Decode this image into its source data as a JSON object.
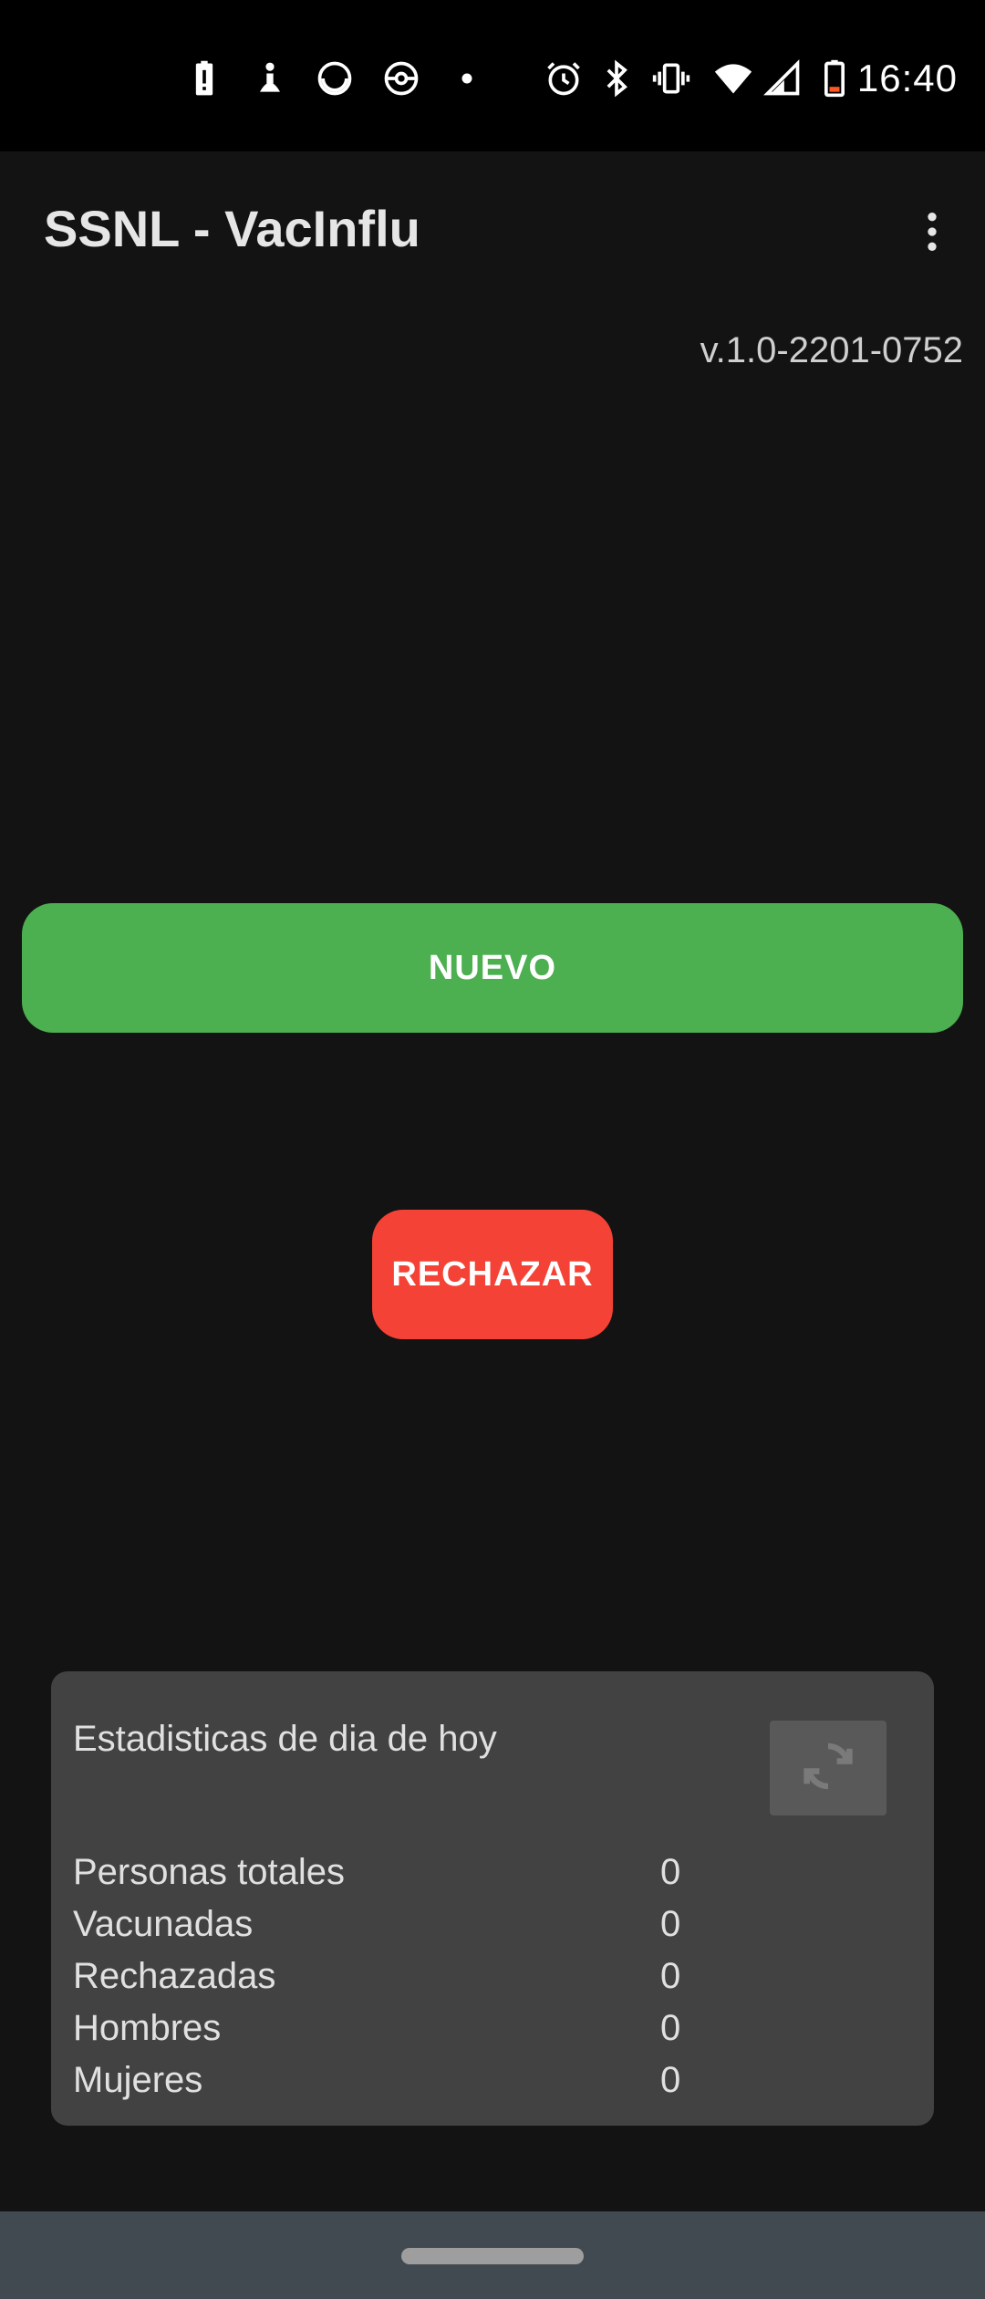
{
  "status_bar": {
    "time": "16:40",
    "icons": [
      "battery-alert-icon",
      "accessibility-icon",
      "sync-circle-icon",
      "pokeball-icon",
      "dot-icon",
      "alarm-icon",
      "bluetooth-icon",
      "vibrate-icon",
      "wifi-icon",
      "signal-icon",
      "battery-low-icon"
    ]
  },
  "app_bar": {
    "title": "SSNL - VacInflu",
    "menu_icon": "more-vert-icon"
  },
  "version": "v.1.0-2201-0752",
  "buttons": {
    "nuevo": "NUEVO",
    "rechazar": "RECHAZAR"
  },
  "colors": {
    "nuevo": "#4caf50",
    "rechazar": "#f44336",
    "background": "#131313",
    "card": "#424242"
  },
  "stats": {
    "title": "Estadisticas de dia de hoy",
    "refresh_icon": "refresh-icon",
    "rows": [
      {
        "label": "Personas totales",
        "value": "0"
      },
      {
        "label": "Vacunadas",
        "value": "0"
      },
      {
        "label": "Rechazadas",
        "value": "0"
      },
      {
        "label": "Hombres",
        "value": "0"
      },
      {
        "label": "Mujeres",
        "value": "0"
      }
    ]
  }
}
